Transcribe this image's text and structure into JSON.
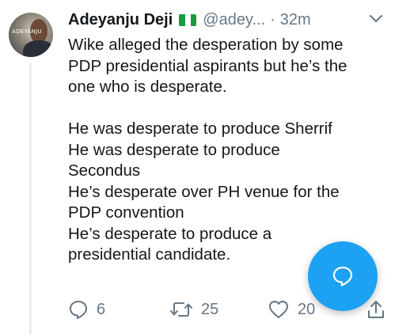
{
  "tweet": {
    "author_name": "Adeyanju Deji",
    "author_handle": "@adey...",
    "separator": "·",
    "time": "32m",
    "avatar_label": "ADEYANJU",
    "lines": [
      "Wike alleged the desperation by some",
      "PDP presidential aspirants but he’s the",
      "one who is desperate.",
      "",
      "He was desperate to produce Sherrif",
      "He was desperate to produce",
      "Secondus",
      "He’s desperate over PH venue for the",
      "PDP convention",
      "He’s desperate to produce a",
      "presidential candidate."
    ]
  },
  "actions": {
    "reply_count": "6",
    "retweet_count": "25",
    "like_count": "20"
  },
  "icons": {
    "flag": "nigeria-flag-icon",
    "menu": "chevron-down-icon",
    "reply": "reply-icon",
    "retweet": "retweet-icon",
    "like": "heart-icon",
    "share": "share-icon",
    "compose": "compose-reply-icon"
  },
  "colors": {
    "accent": "#1da1f2",
    "secondary_text": "#657786",
    "flag_green": "#1a9b40"
  }
}
